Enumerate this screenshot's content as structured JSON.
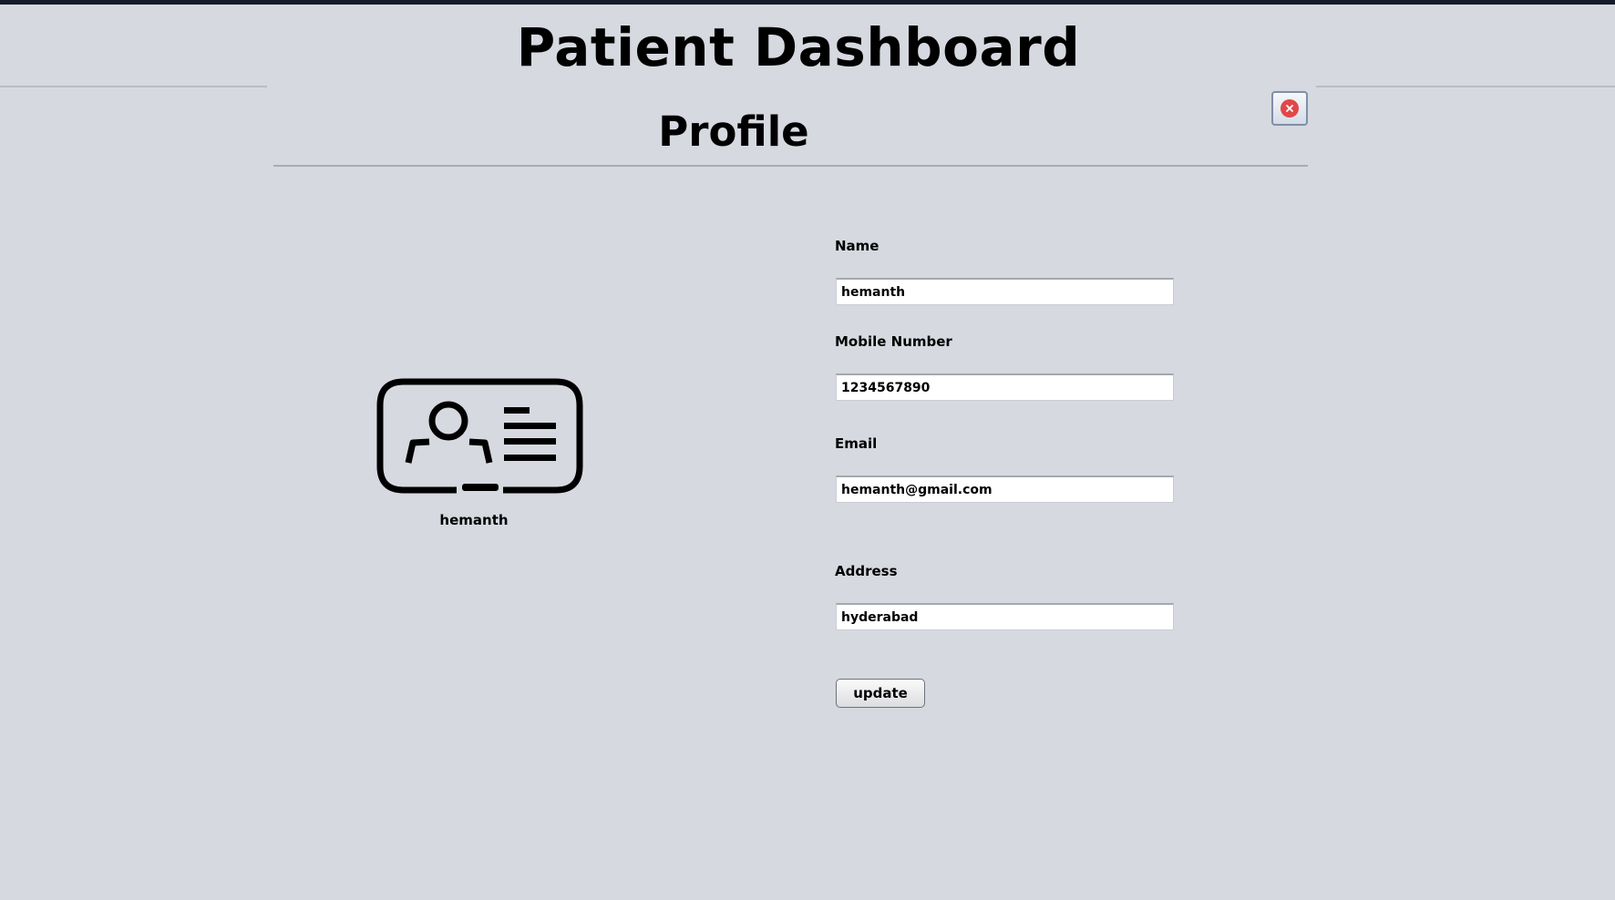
{
  "app": {
    "title": "Patient Dashboard"
  },
  "profile": {
    "heading": "Profile",
    "close_icon": "close-icon",
    "avatar_icon": "id-card-icon",
    "display_name": "hemanth"
  },
  "form": {
    "name_label": "Name",
    "name_value": "hemanth",
    "mobile_label": "Mobile Number",
    "mobile_value": "1234567890",
    "email_label": "Email",
    "email_value": "hemanth@gmail.com",
    "address_label": "Address",
    "address_value": "hyderabad",
    "update_label": "update"
  },
  "colors": {
    "background": "#d6d9e0",
    "topbar": "#141c2c",
    "close_accent": "#e04848"
  }
}
